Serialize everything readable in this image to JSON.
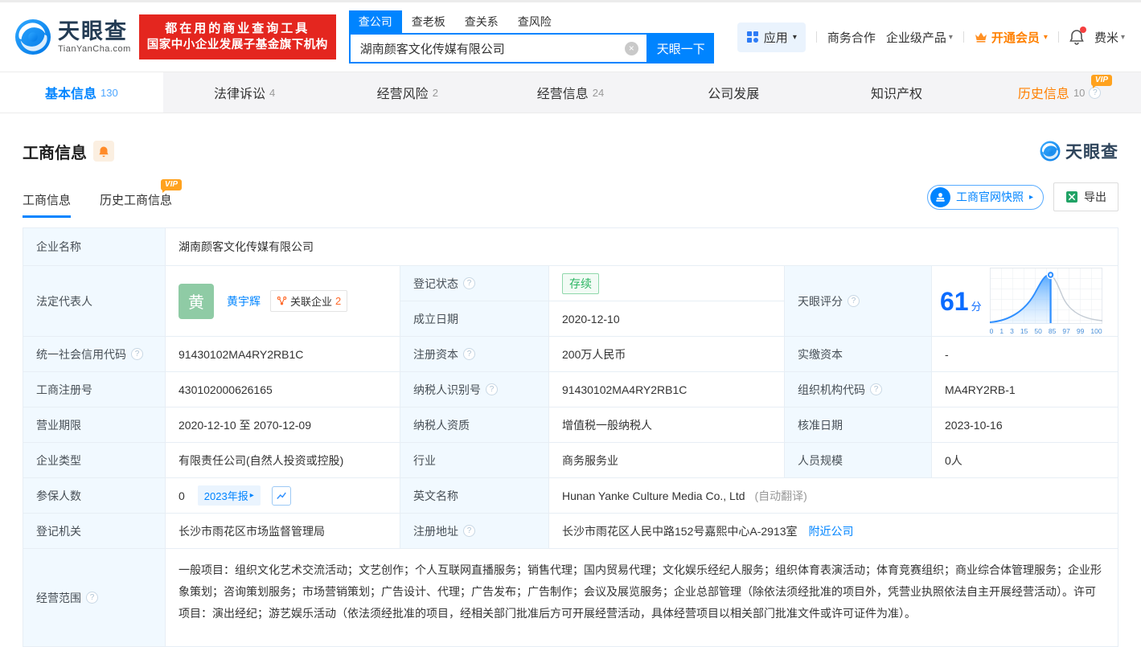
{
  "brand": {
    "logo_text": "天眼查",
    "logo_domain": "TianYanCha.com",
    "slogan_line1": "都在用的商业查询工具",
    "slogan_line2": "国家中小企业发展子基金旗下机构"
  },
  "search": {
    "tabs": [
      {
        "label": "查公司",
        "active": true
      },
      {
        "label": "查老板"
      },
      {
        "label": "查关系"
      },
      {
        "label": "查风险"
      }
    ],
    "query": "湖南颜客文化传媒有限公司",
    "button_label": "天眼一下"
  },
  "top_nav": {
    "apps_label": "应用",
    "cooperation_label": "商务合作",
    "enterprise_label": "企业级产品",
    "vip_label": "开通会员",
    "user_label": "费米"
  },
  "main_tabs": [
    {
      "label": "基本信息",
      "count": "130"
    },
    {
      "label": "法律诉讼",
      "count": "4"
    },
    {
      "label": "经营风险",
      "count": "2"
    },
    {
      "label": "经营信息",
      "count": "24"
    },
    {
      "label": "公司发展",
      "count": ""
    },
    {
      "label": "知识产权",
      "count": ""
    },
    {
      "label": "历史信息",
      "count": "10"
    }
  ],
  "badges": {
    "vip": "VIP"
  },
  "icons": {
    "help": "?",
    "caret_down": "▾",
    "caret_right": "▸",
    "clear": "×"
  },
  "section": {
    "title": "工商信息",
    "subtab_current": "工商信息",
    "subtab_history": "历史工商信息",
    "snapshot_button": "工商官网快照",
    "export_button": "导出",
    "watermark_logo_text": "天眼查"
  },
  "info": {
    "company_name_label": "企业名称",
    "company_name": "湖南颜客文化传媒有限公司",
    "legal_rep_label": "法定代表人",
    "legal_rep_avatar": "黄",
    "legal_rep_name": "黄宇辉",
    "related_label": "关联企业",
    "related_count": "2",
    "status_label": "登记状态",
    "status_value": "存续",
    "established_label": "成立日期",
    "established_value": "2020-12-10",
    "score_label": "天眼评分",
    "credit_code_label": "统一社会信用代码",
    "credit_code": "91430102MA4RY2RB1C",
    "reg_capital_label": "注册资本",
    "reg_capital": "200万人民币",
    "paid_capital_label": "实缴资本",
    "paid_capital": "-",
    "reg_number_label": "工商注册号",
    "reg_number": "430102000626165",
    "taxpayer_id_label": "纳税人识别号",
    "taxpayer_id": "91430102MA4RY2RB1C",
    "org_code_label": "组织机构代码",
    "org_code": "MA4RY2RB-1",
    "business_term_label": "营业期限",
    "business_term": "2020-12-10 至 2070-12-09",
    "taxpayer_quality_label": "纳税人资质",
    "taxpayer_quality": "增值税一般纳税人",
    "approval_date_label": "核准日期",
    "approval_date": "2023-10-16",
    "company_type_label": "企业类型",
    "company_type": "有限责任公司(自然人投资或控股)",
    "industry_label": "行业",
    "industry": "商务服务业",
    "staff_size_label": "人员规模",
    "staff_size": "0人",
    "insured_label": "参保人数",
    "insured_value": "0",
    "annual_report_badge": "2023年报",
    "english_name_label": "英文名称",
    "english_name": "Hunan Yanke Culture Media Co., Ltd",
    "english_name_note": "(自动翻译)",
    "registry_label": "登记机关",
    "registry": "长沙市雨花区市场监督管理局",
    "address_label": "注册地址",
    "address": "长沙市雨花区人民中路152号嘉熙中心A-2913室",
    "nearby_link": "附近公司",
    "business_scope_label": "经营范围",
    "business_scope": "一般项目：组织文化艺术交流活动；文艺创作；个人互联网直播服务；销售代理；国内贸易代理；文化娱乐经纪人服务；组织体育表演活动；体育竞赛组织；商业综合体管理服务；企业形象策划；咨询策划服务；市场营销策划；广告设计、代理；广告发布；广告制作；会议及展览服务；企业总部管理（除依法须经批准的项目外，凭营业执照依法自主开展经营活动）。许可项目：演出经纪；游艺娱乐活动（依法须经批准的项目，经相关部门批准后方可开展经营活动，具体经营项目以相关部门批准文件或许可证件为准）。"
  },
  "chart_data": {
    "type": "area",
    "title": "天眼评分",
    "score": 61,
    "score_unit": "分",
    "x_ticks": [
      "0",
      "1",
      "3",
      "15",
      "50",
      "85",
      "97",
      "99",
      "100"
    ],
    "marker_value": 61,
    "ylabel": "",
    "xlabel": "",
    "legend": "off",
    "grid": "on"
  },
  "colors": {
    "primary": "#0084FF",
    "orange": "#FF8000",
    "banner_red": "#E4261F",
    "status_green": "#2BB562",
    "avatar_green": "#8FCBA5"
  }
}
